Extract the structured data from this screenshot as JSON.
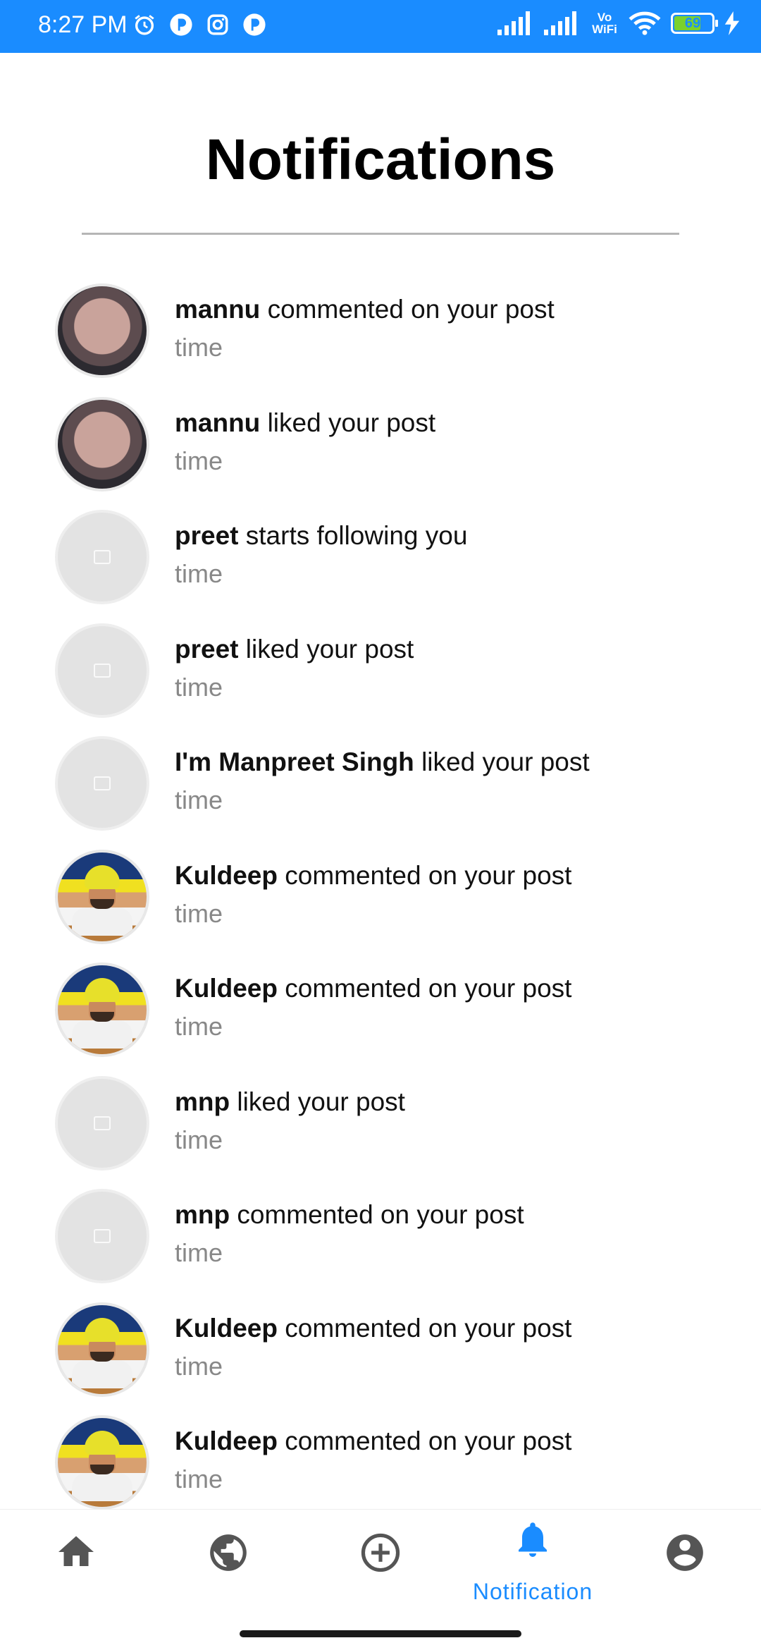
{
  "status_bar": {
    "time": "8:27 PM",
    "battery_level": "69",
    "network_label": "Vo WiFi"
  },
  "page": {
    "title": "Notifications"
  },
  "notifications": [
    {
      "user": "mannu",
      "action": "commented on your post",
      "time": "time",
      "avatar": "baby-photo"
    },
    {
      "user": "mannu",
      "action": "liked your post",
      "time": "time",
      "avatar": "baby-photo"
    },
    {
      "user": "preet",
      "action": "starts following you",
      "time": "time",
      "avatar": "placeholder"
    },
    {
      "user": "preet",
      "action": "liked your post",
      "time": "time",
      "avatar": "placeholder"
    },
    {
      "user": "I'm Manpreet Singh",
      "action": "liked your post",
      "time": "time",
      "avatar": "placeholder"
    },
    {
      "user": "Kuldeep",
      "action": "commented on your post",
      "time": "time",
      "avatar": "kuldeep-photo"
    },
    {
      "user": "Kuldeep",
      "action": "commented on your post",
      "time": "time",
      "avatar": "kuldeep-photo"
    },
    {
      "user": "mnp",
      "action": "liked your post",
      "time": "time",
      "avatar": "placeholder"
    },
    {
      "user": "mnp",
      "action": "commented on your post",
      "time": "time",
      "avatar": "placeholder"
    },
    {
      "user": "Kuldeep",
      "action": "commented on your post",
      "time": "time",
      "avatar": "kuldeep-photo"
    },
    {
      "user": "Kuldeep",
      "action": "commented on your post",
      "time": "time",
      "avatar": "kuldeep-photo"
    }
  ],
  "bottom_nav": {
    "items": [
      {
        "icon": "home-icon",
        "label": ""
      },
      {
        "icon": "globe-icon",
        "label": ""
      },
      {
        "icon": "add-circle-icon",
        "label": ""
      },
      {
        "icon": "bell-icon",
        "label": "Notification",
        "active": true
      },
      {
        "icon": "account-icon",
        "label": ""
      }
    ],
    "active_color": "#1a8cff",
    "inactive_color": "#555555"
  },
  "colors": {
    "status_bar_bg": "#1a8cff",
    "accent": "#1a8cff"
  }
}
